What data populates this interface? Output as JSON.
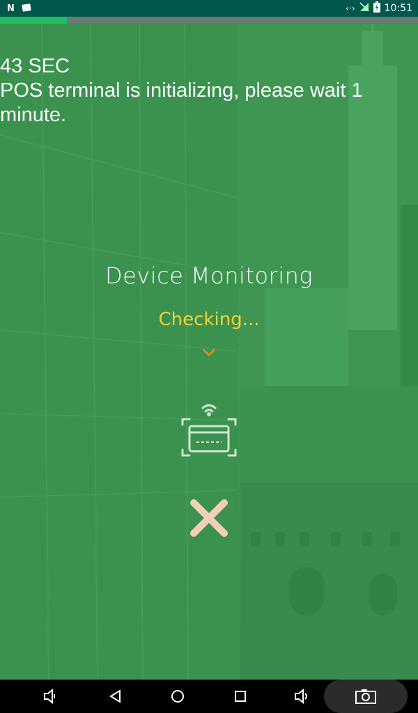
{
  "status_bar": {
    "time": "10:51",
    "left_icons": [
      "n-app-icon",
      "notification-icon"
    ],
    "right_icons": [
      "data-transfer-icon",
      "no-signal-icon",
      "battery-charging-icon"
    ]
  },
  "progress": {
    "fraction": 0.16,
    "fill_color": "#1fbf66",
    "track_color": "#6b7a75"
  },
  "countdown": {
    "text": "43 SEC"
  },
  "message": {
    "text": "POS terminal is initializing, please wait 1 minute."
  },
  "device_monitor": {
    "title": "Device Monitoring",
    "status": "Checking...",
    "status_color": "#f0d23a",
    "chevron_color": "#e08a1a",
    "device_icon": "contactless-card-reader-icon",
    "close_icon": "close-icon",
    "close_color": "#f3cfb8"
  },
  "nav_bar": {
    "buttons": [
      "volume-down-icon",
      "back-icon",
      "home-icon",
      "recents-icon",
      "volume-up-icon",
      "screenshot-icon"
    ]
  },
  "theme": {
    "overlay_green": "#3f9a55",
    "status_bar_color": "#00574b"
  }
}
